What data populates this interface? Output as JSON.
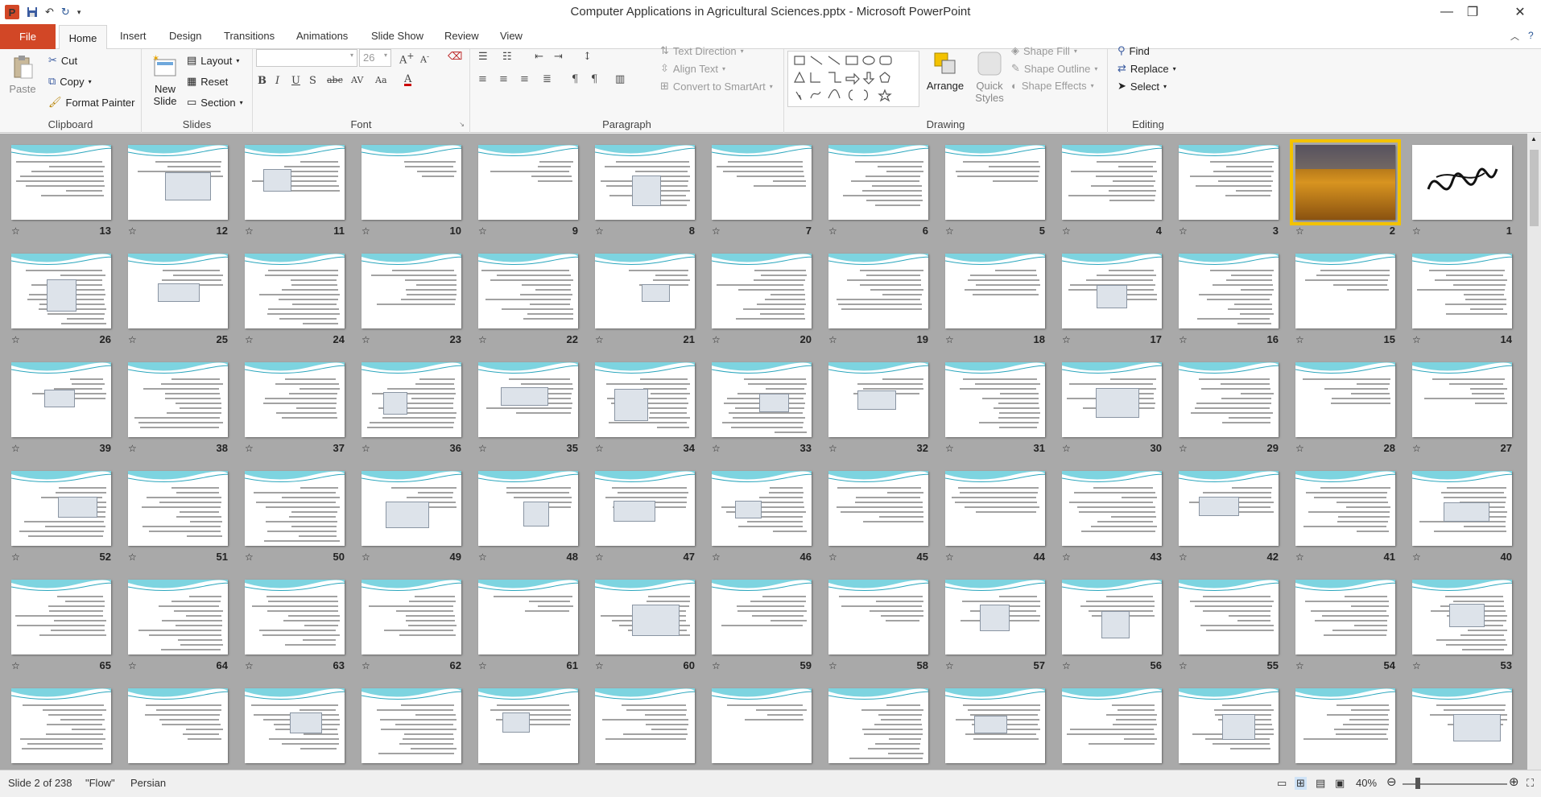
{
  "window": {
    "title": "Computer Applications in Agricultural Sciences.pptx - Microsoft PowerPoint"
  },
  "qat": {
    "undo": "↶",
    "redo": "↻"
  },
  "tabs": {
    "file": "File",
    "home": "Home",
    "insert": "Insert",
    "design": "Design",
    "transitions": "Transitions",
    "animations": "Animations",
    "slideshow": "Slide Show",
    "review": "Review",
    "view": "View"
  },
  "ribbon": {
    "clipboard": {
      "label": "Clipboard",
      "paste": "Paste",
      "cut": "Cut",
      "copy": "Copy",
      "format_painter": "Format Painter"
    },
    "slides": {
      "label": "Slides",
      "new_slide": "New Slide",
      "layout": "Layout",
      "reset": "Reset",
      "section": "Section"
    },
    "font": {
      "label": "Font",
      "size": "26"
    },
    "paragraph": {
      "label": "Paragraph",
      "text_direction": "Text Direction",
      "align_text": "Align Text",
      "convert_smartart": "Convert to SmartArt"
    },
    "drawing": {
      "label": "Drawing",
      "arrange": "Arrange",
      "quick_styles": "Quick Styles",
      "shape_fill": "Shape Fill",
      "shape_outline": "Shape Outline",
      "shape_effects": "Shape Effects"
    },
    "editing": {
      "label": "Editing",
      "find": "Find",
      "replace": "Replace",
      "select": "Select"
    }
  },
  "colors": {
    "accent": "#d24726",
    "selection": "#f2c200",
    "sorter_bg": "#a9a9a9"
  },
  "slides": {
    "selected": 2,
    "visible_count": 78
  },
  "status": {
    "slide_info": "Slide 2 of 238",
    "theme": "\"Flow\"",
    "language": "Persian",
    "zoom": "40%"
  }
}
